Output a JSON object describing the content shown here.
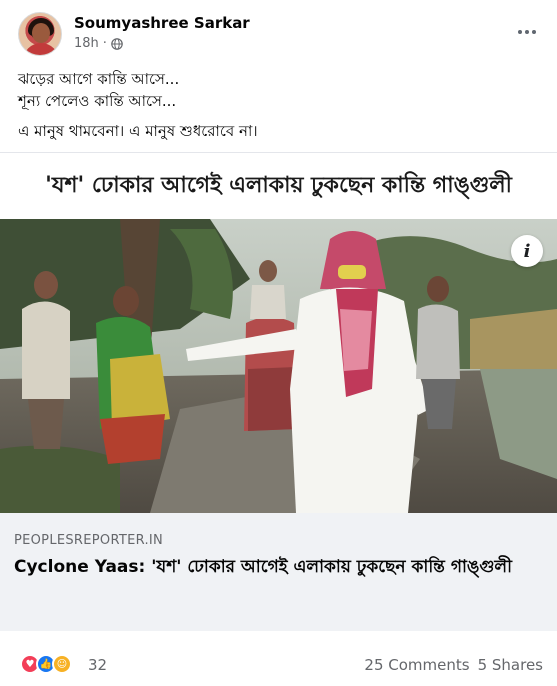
{
  "post": {
    "author": "Soumyashree Sarkar",
    "time": "18h",
    "privacy_icon": "globe-icon",
    "more_icon": "more-options-icon",
    "text_lines": [
      "ঝড়ের আগে কান্তি আসে...",
      "শূন্য পেলেও কান্তি আসে...",
      "এ মানুষ থামবেনা। এ মানুষ শুধরোবে না।"
    ]
  },
  "link_card": {
    "image_headline": "'যশ' ঢোকার আগেই এলাকায় ঢুকছেন কান্তি গাঙ্গুলী",
    "info_label": "i",
    "domain": "PEOPLESREPORTER.IN",
    "title": "Cyclone Yaas: 'যশ' ঢোকার আগেই এলাকায় ঢুকছেন কান্তি গাঙ্গুলী"
  },
  "reactions": {
    "types": [
      "love",
      "like",
      "care"
    ],
    "count": "32",
    "comments": "25 Comments",
    "shares": "5 Shares"
  },
  "colors": {
    "secondary_text": "#65676b",
    "footer_bg": "#f0f2f5",
    "like": "#1877f2",
    "love": "#f33e58",
    "care": "#f7b125"
  }
}
